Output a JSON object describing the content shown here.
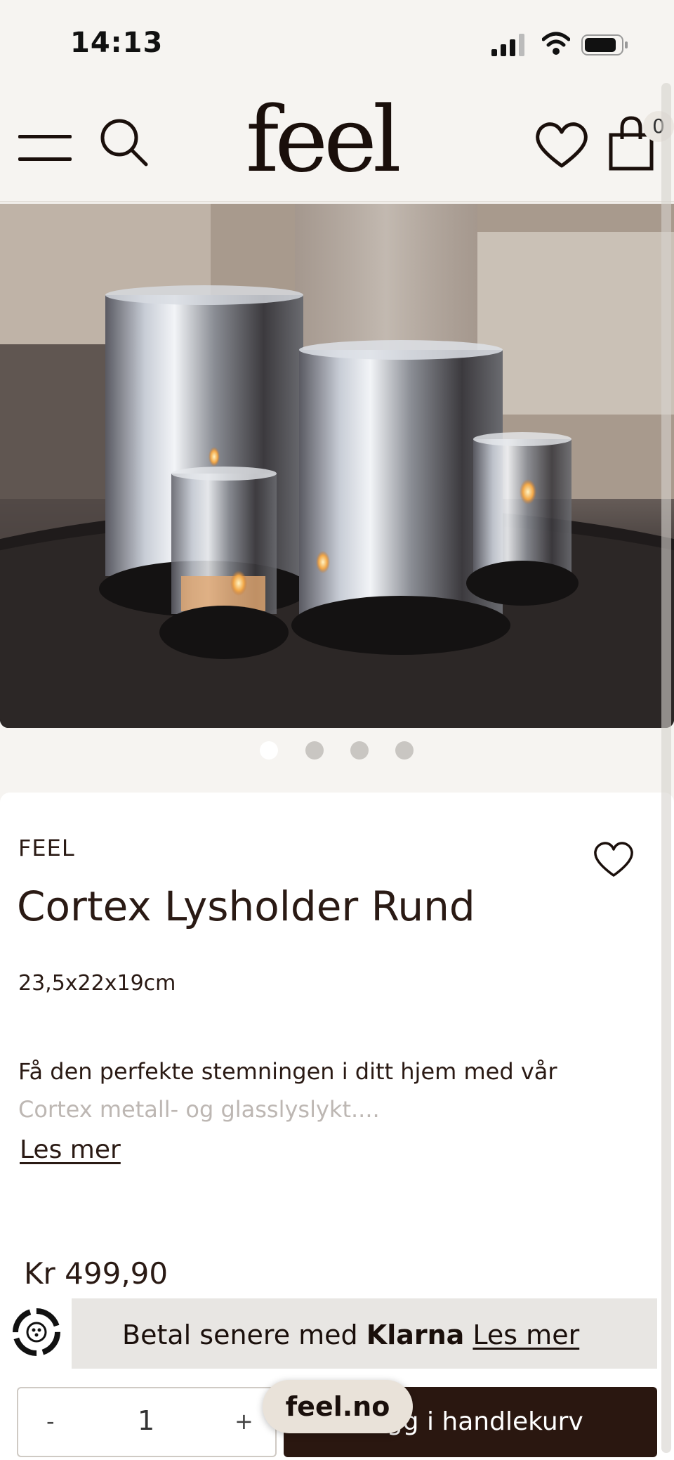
{
  "status_bar": {
    "time": "14:13"
  },
  "header": {
    "logo": "feel",
    "cart_count": "0"
  },
  "gallery": {
    "dot_count": 4,
    "active_index": 0
  },
  "product": {
    "brand": "FEEL",
    "title": "Cortex Lysholder Rund",
    "dimensions": "23,5x22x19cm",
    "description_line1": "Få den perfekte stemningen i ditt hjem med vår",
    "description_line2": "Cortex metall- og glasslyslykt....",
    "read_more": "Les mer",
    "price": "Kr 499,90"
  },
  "klarna": {
    "prefix": "Betal senere med ",
    "brand": "Klarna",
    "link": "Les mer"
  },
  "cart": {
    "minus": "-",
    "quantity": "1",
    "plus": "+",
    "add_label": "Legg i handlekurv"
  },
  "browser": {
    "url": "feel.no"
  }
}
